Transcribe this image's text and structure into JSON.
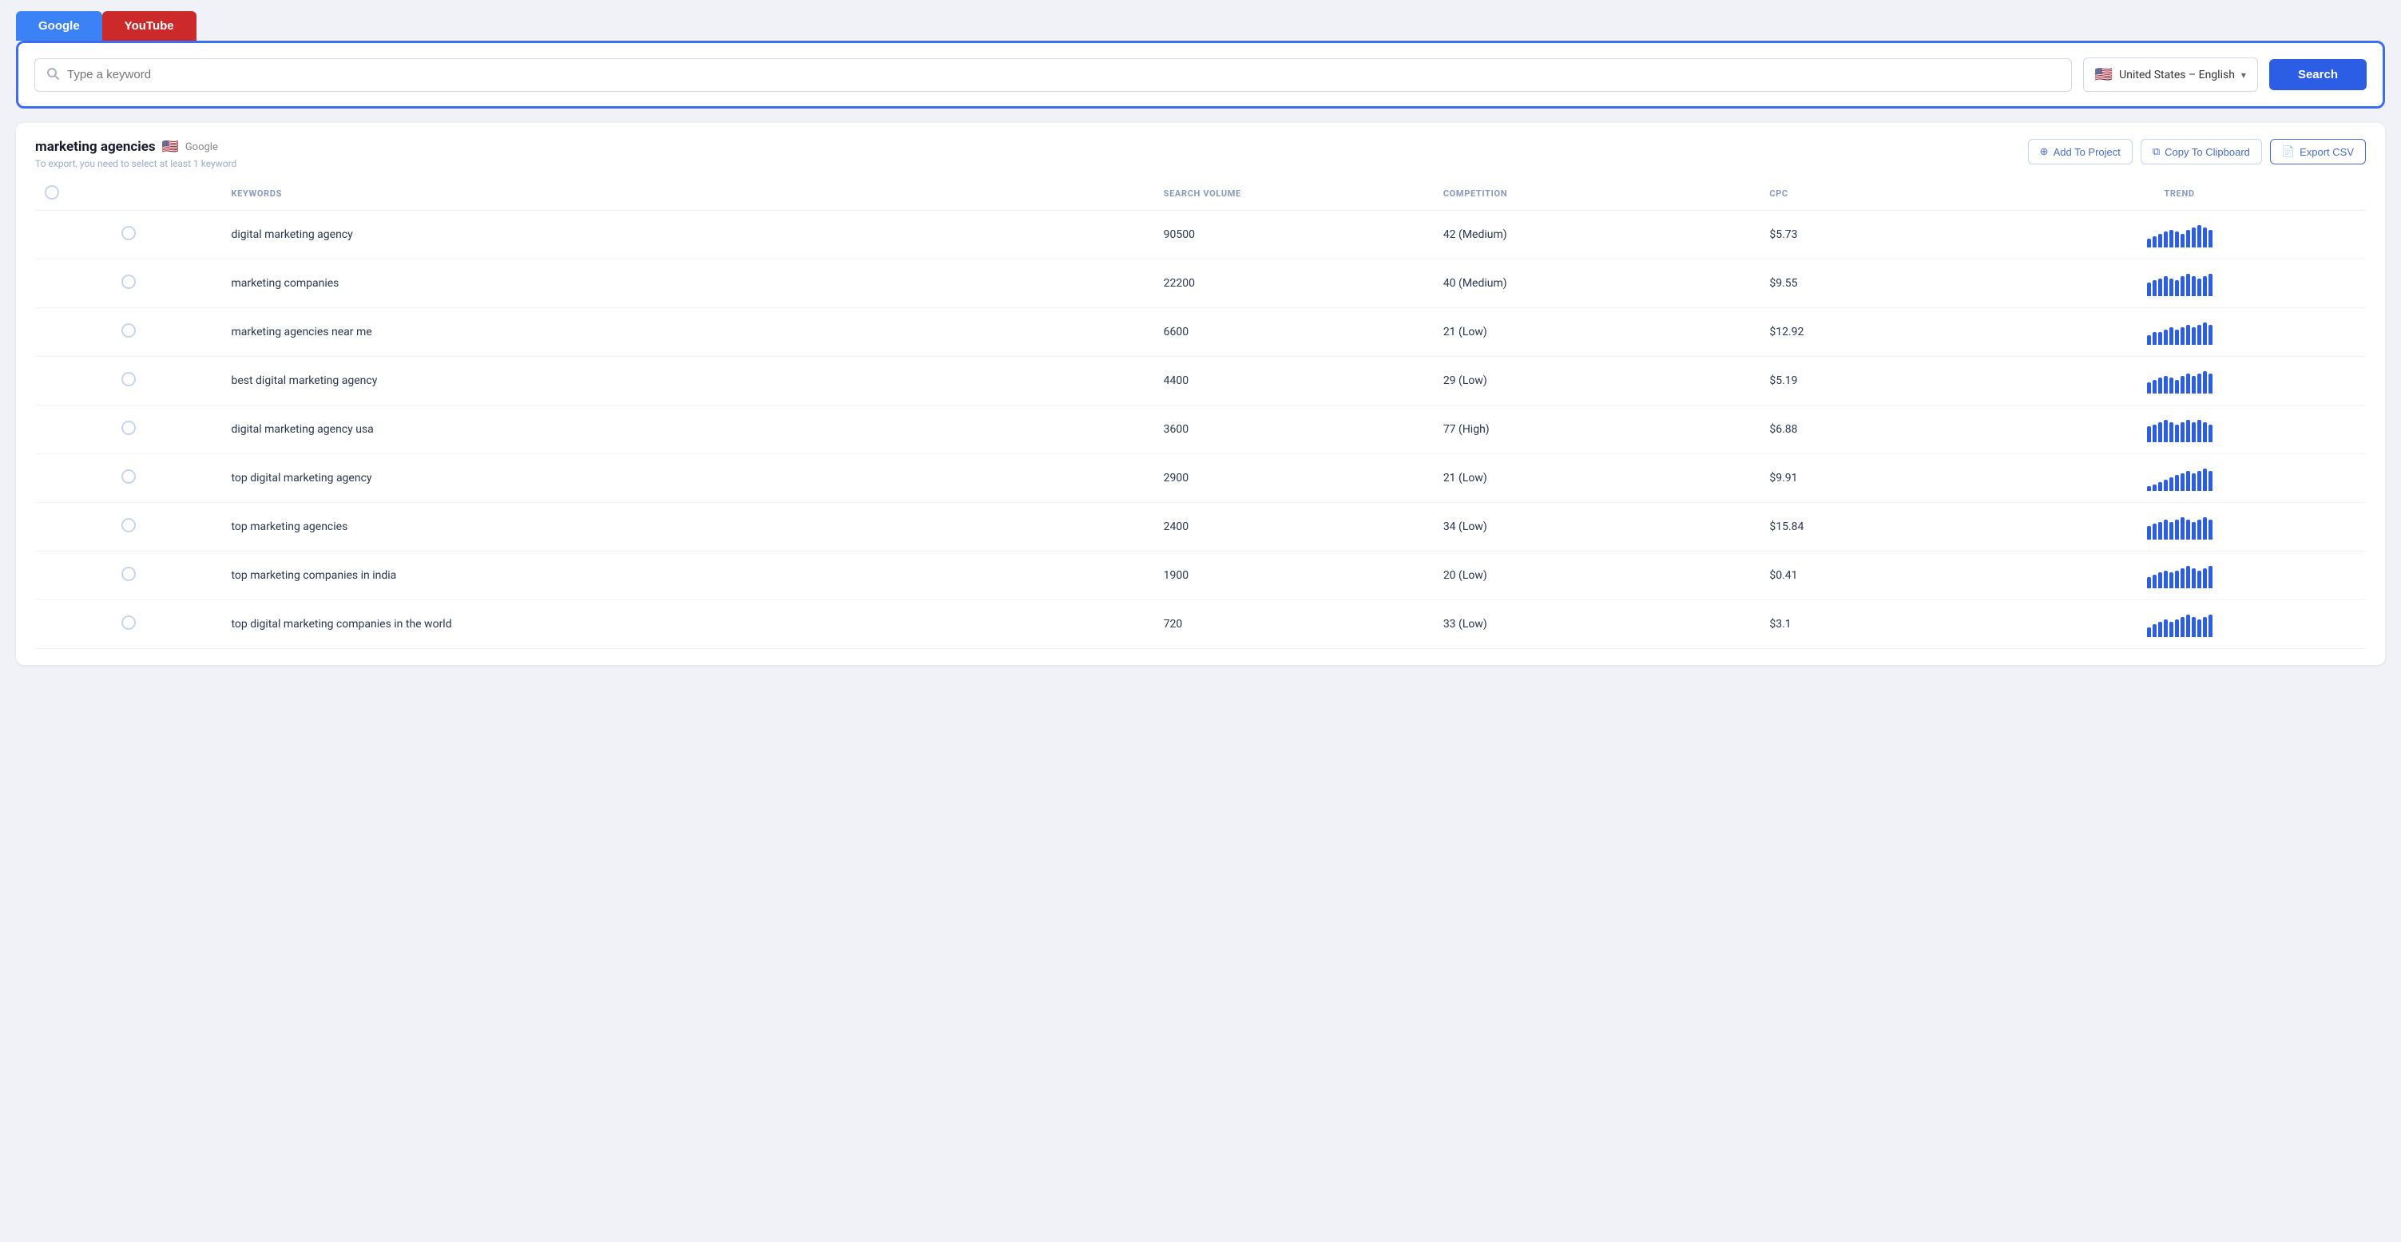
{
  "tabs": [
    {
      "id": "google",
      "label": "Google"
    },
    {
      "id": "youtube",
      "label": "YouTube"
    }
  ],
  "search": {
    "placeholder": "Type a keyword",
    "locale": "United States – English",
    "flag": "🇺🇸",
    "button_label": "Search"
  },
  "results": {
    "title": "marketing agencies",
    "flag": "🇺🇸",
    "source": "Google",
    "subtitle": "To export, you need to select at least 1 keyword",
    "add_to_project": "Add To Project",
    "copy_to_clipboard": "Copy To Clipboard",
    "export_csv": "Export CSV"
  },
  "table": {
    "columns": {
      "keywords": "KEYWORDS",
      "search_volume": "SEARCH VOLUME",
      "competition": "COMPETITION",
      "cpc": "CPC",
      "trend": "TREND"
    },
    "rows": [
      {
        "keyword": "digital marketing agency",
        "search_volume": "90500",
        "competition": "42 (Medium)",
        "cpc": "$5.73",
        "trend": [
          4,
          5,
          6,
          7,
          8,
          7,
          6,
          8,
          9,
          10,
          9,
          8
        ]
      },
      {
        "keyword": "marketing companies",
        "search_volume": "22200",
        "competition": "40 (Medium)",
        "cpc": "$9.55",
        "trend": [
          6,
          7,
          8,
          9,
          8,
          7,
          9,
          10,
          9,
          8,
          9,
          10
        ]
      },
      {
        "keyword": "marketing agencies near me",
        "search_volume": "6600",
        "competition": "21 (Low)",
        "cpc": "$12.92",
        "trend": [
          4,
          5,
          5,
          6,
          7,
          6,
          7,
          8,
          7,
          8,
          9,
          8
        ]
      },
      {
        "keyword": "best digital marketing agency",
        "search_volume": "4400",
        "competition": "29 (Low)",
        "cpc": "$5.19",
        "trend": [
          5,
          6,
          7,
          8,
          7,
          6,
          8,
          9,
          8,
          9,
          10,
          9
        ]
      },
      {
        "keyword": "digital marketing agency usa",
        "search_volume": "3600",
        "competition": "77 (High)",
        "cpc": "$6.88",
        "trend": [
          7,
          8,
          9,
          10,
          9,
          8,
          9,
          10,
          9,
          10,
          9,
          8
        ]
      },
      {
        "keyword": "top digital marketing agency",
        "search_volume": "2900",
        "competition": "21 (Low)",
        "cpc": "$9.91",
        "trend": [
          2,
          3,
          4,
          5,
          6,
          7,
          8,
          9,
          8,
          9,
          10,
          9
        ]
      },
      {
        "keyword": "top marketing agencies",
        "search_volume": "2400",
        "competition": "34 (Low)",
        "cpc": "$15.84",
        "trend": [
          6,
          7,
          8,
          9,
          8,
          9,
          10,
          9,
          8,
          9,
          10,
          9
        ]
      },
      {
        "keyword": "top marketing companies in india",
        "search_volume": "1900",
        "competition": "20 (Low)",
        "cpc": "$0.41",
        "trend": [
          5,
          6,
          7,
          8,
          7,
          8,
          9,
          10,
          9,
          8,
          9,
          10
        ]
      },
      {
        "keyword": "top digital marketing companies in the world",
        "search_volume": "720",
        "competition": "33 (Low)",
        "cpc": "$3.1",
        "trend": [
          4,
          5,
          6,
          7,
          6,
          7,
          8,
          9,
          8,
          7,
          8,
          9
        ]
      }
    ]
  }
}
